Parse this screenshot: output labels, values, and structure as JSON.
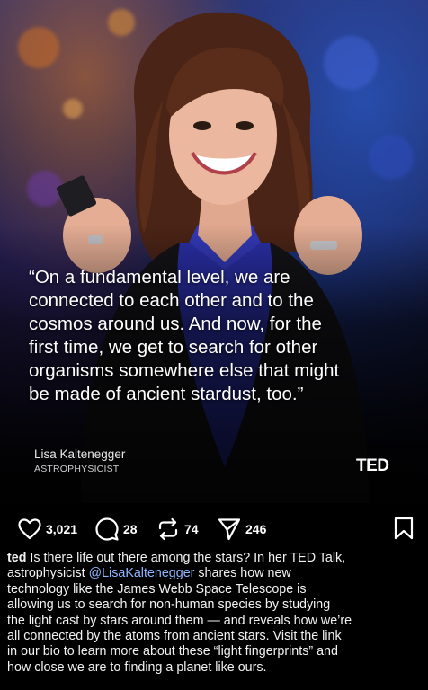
{
  "post": {
    "quote_lines": [
      "“On a fundamental level, we are",
      "connected to each other and to the",
      "cosmos around us. And now, for the",
      "first time, we get to search for other",
      "organisms somewhere else that might",
      "be made of ancient stardust, too.”"
    ],
    "speaker_name": "Lisa Kaltenegger",
    "speaker_title": "ASTROPHYSICIST",
    "brand_logo": "TED"
  },
  "actions": {
    "likes": "3,021",
    "comments": "28",
    "reposts": "74",
    "shares": "246",
    "like_icon": "heart-icon",
    "comment_icon": "comment-icon",
    "repost_icon": "repost-icon",
    "share_icon": "send-icon",
    "bookmark_icon": "bookmark-icon"
  },
  "caption": {
    "username": "ted",
    "line1_text": " Is there life out there among the stars? In her TED Talk,",
    "line2_prefix": "astrophysicist ",
    "mention": "@LisaKaltenegger",
    "line2_suffix": " shares how new",
    "lines": [
      "technology like the James Webb Space Telescope is",
      "allowing us to search for non-human species by studying",
      "the light cast by stars around them — and reveals how we’re",
      "all connected by the atoms from ancient stars. Visit the link",
      "in our bio to learn more about these “light fingerprints” and",
      "how close we are to finding a planet like ours."
    ]
  },
  "colors": {
    "background": "#000000",
    "text": "#ffffff",
    "mention": "#8eb6ff",
    "shirt": "#2a2fa8"
  }
}
